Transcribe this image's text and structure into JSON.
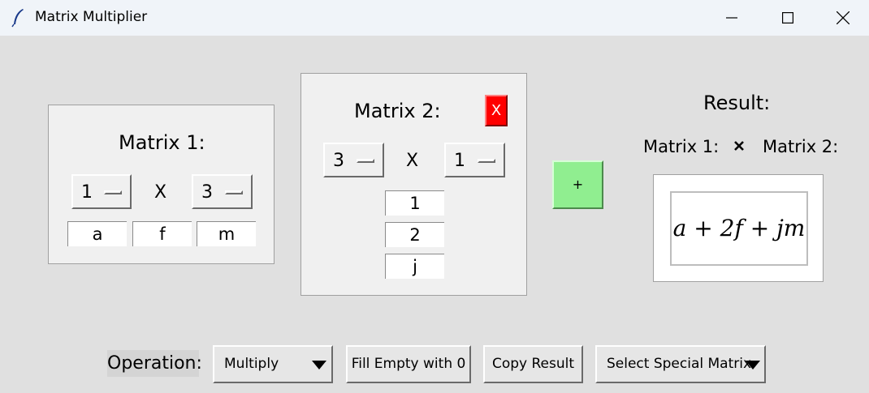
{
  "window": {
    "title": "Matrix Multiplier"
  },
  "matrix1": {
    "title": "Matrix 1:",
    "rows": "1",
    "cols": "3",
    "times": "X",
    "cells": [
      "a",
      "f",
      "m"
    ]
  },
  "matrix2": {
    "title": "Matrix 2:",
    "remove_label": "X",
    "rows": "3",
    "cols": "1",
    "times": "X",
    "cells": [
      "1",
      "2",
      "j"
    ]
  },
  "add_label": "+",
  "result": {
    "title": "Result:",
    "left_label": "Matrix 1:",
    "right_label": "Matrix 2:",
    "expression": "a + 2f + jm"
  },
  "controls": {
    "operation_label": "Operation:",
    "operation_value": "Multiply",
    "fill_label": "Fill Empty with 0",
    "copy_label": "Copy Result",
    "special_label": "Select Special Matrix"
  },
  "icons": {
    "app": "feather-icon",
    "minimize": "minimize-icon",
    "maximize": "maximize-icon",
    "close": "close-icon",
    "times": "times-icon",
    "dropdown": "caret-down-icon"
  },
  "colors": {
    "remove_button": "#ff0000",
    "add_button": "#90ee90",
    "window_bg": "#e0e0e0",
    "frame_bg": "#f0f0f0"
  }
}
